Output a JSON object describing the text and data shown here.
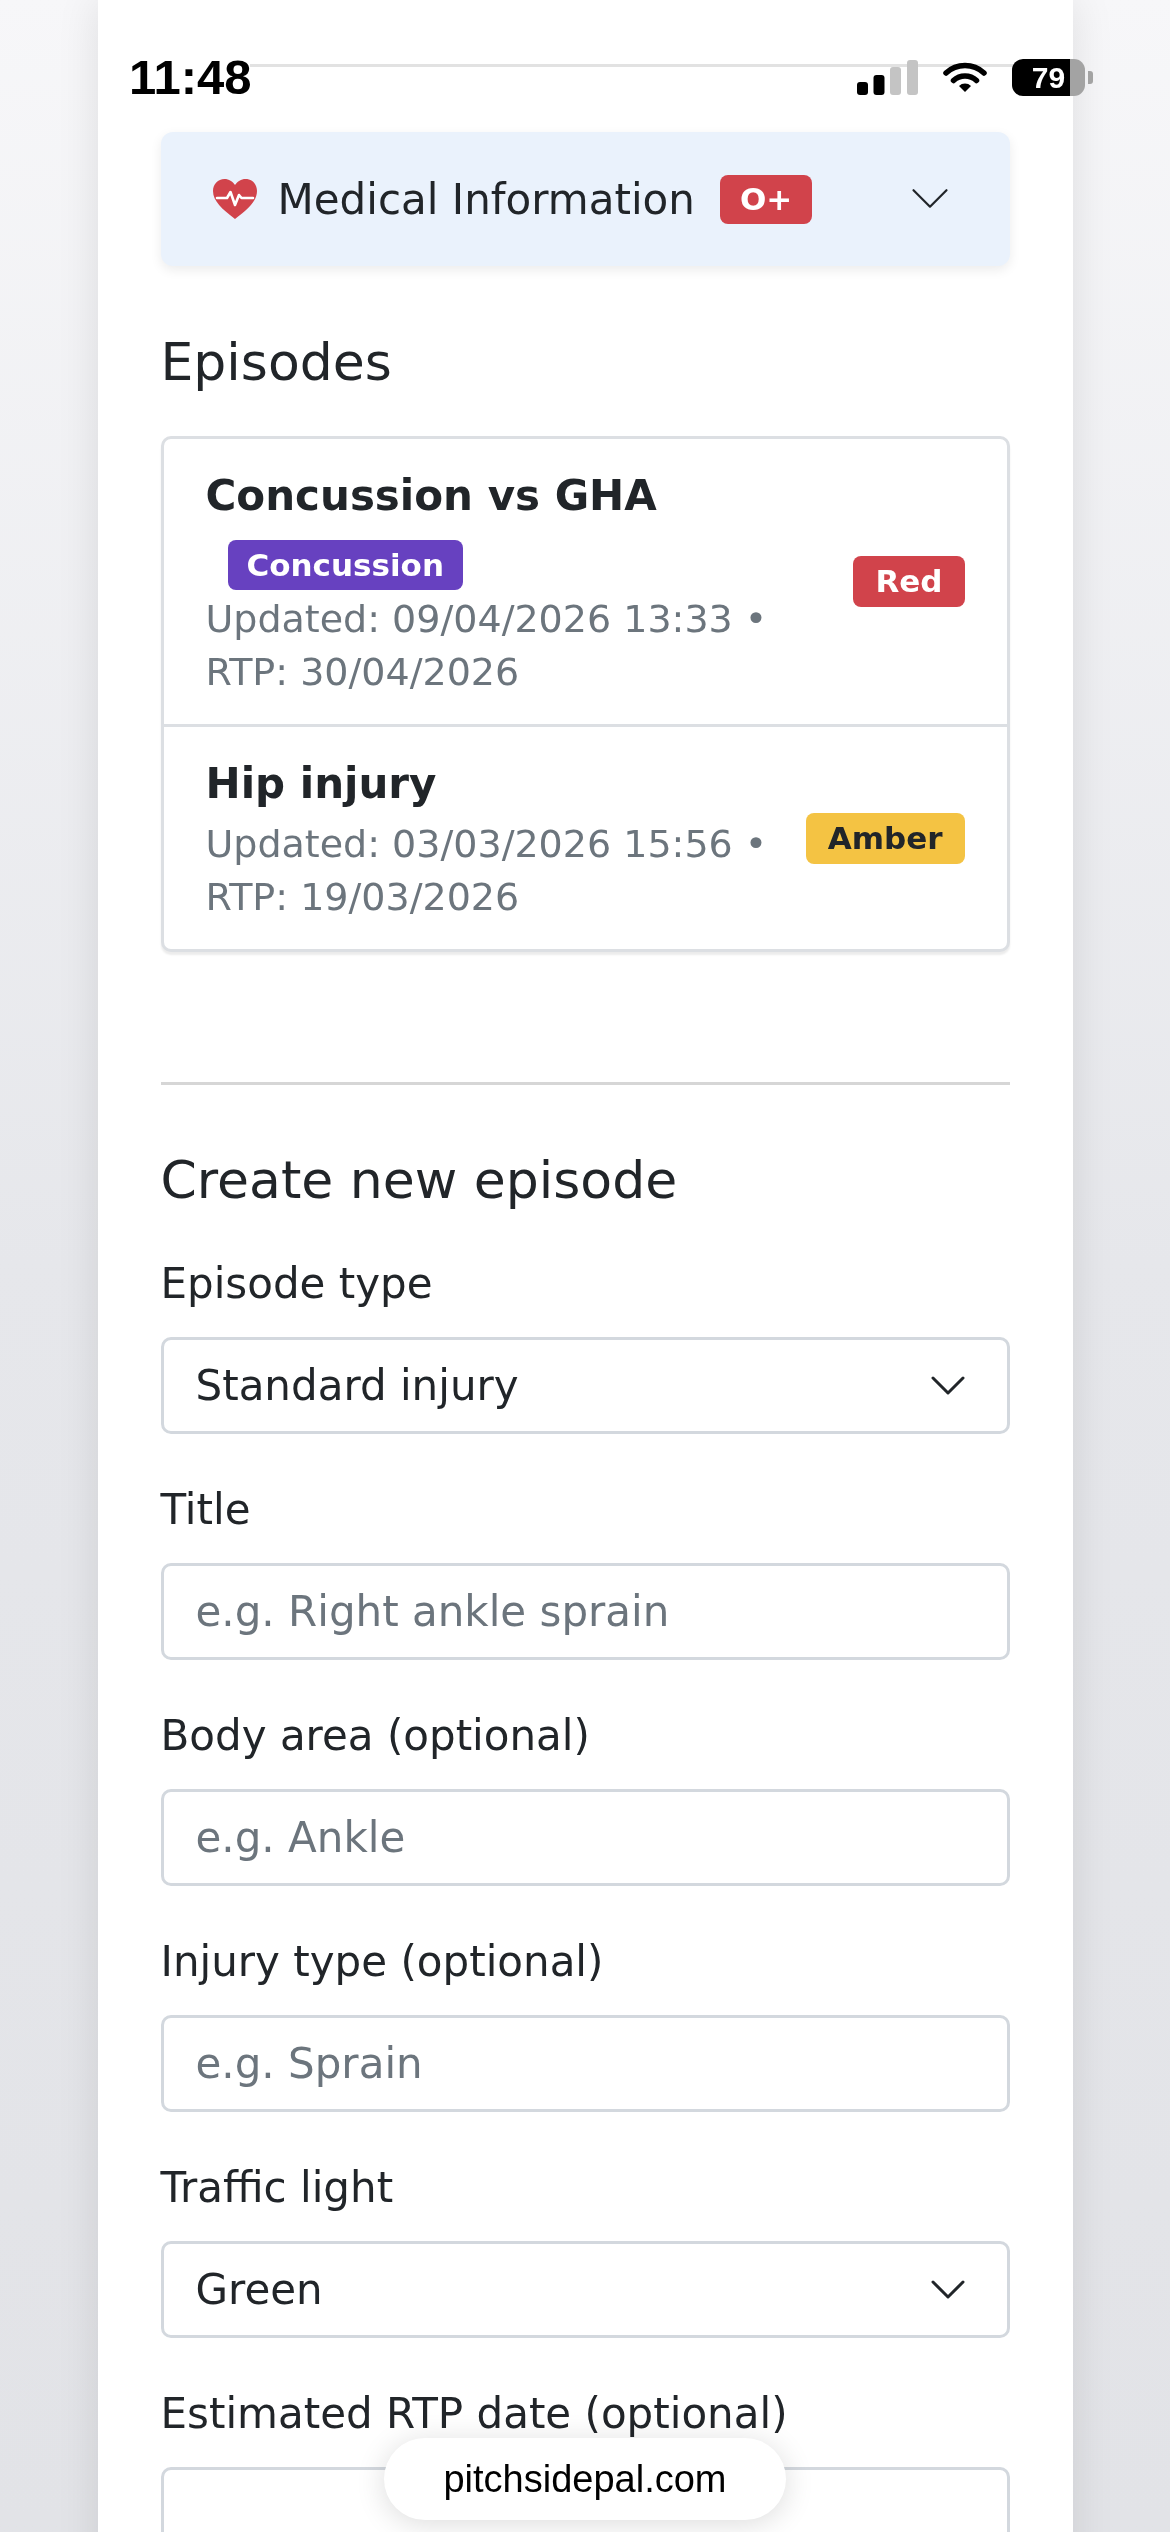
{
  "status_bar": {
    "time": "11:48",
    "battery": "79"
  },
  "medical_info": {
    "title": "Medical Information",
    "blood_type": "O+",
    "expanded": false
  },
  "episodes": {
    "heading": "Episodes",
    "items": [
      {
        "title": "Concussion vs GHA",
        "tag": "Concussion",
        "meta": "Updated: 09/04/2026 13:33 • RTP: 30/04/2026",
        "status": "Red",
        "color": "#d1434b"
      },
      {
        "title": "Hip injury",
        "meta": "Updated: 03/03/2026 15:56 • RTP: 19/03/2026",
        "status": "Amber",
        "color": "#f4c343"
      }
    ]
  },
  "create_episode": {
    "heading": "Create new episode",
    "fields": [
      {
        "kind": "select",
        "label": "Episode type",
        "value": "Standard injury"
      },
      {
        "kind": "text",
        "label": "Title",
        "placeholder": "e.g. Right ankle sprain"
      },
      {
        "kind": "text",
        "label": "Body area (optional)",
        "placeholder": "e.g. Ankle"
      },
      {
        "kind": "text",
        "label": "Injury type (optional)",
        "placeholder": "e.g. Sprain"
      },
      {
        "kind": "select",
        "label": "Traffic light",
        "value": "Green"
      },
      {
        "kind": "date",
        "label": "Estimated RTP date (optional)"
      }
    ]
  },
  "browser": {
    "url": "pitchsidepal.com"
  }
}
